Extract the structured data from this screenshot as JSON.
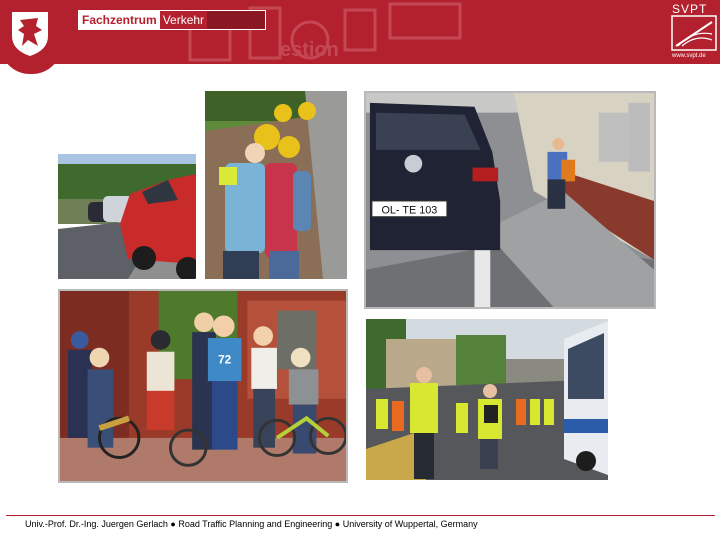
{
  "header": {
    "brand_part1": "Fachzentrum",
    "brand_part2": "Verkehr",
    "logo_title": "SVPT",
    "logo_url": "www.svpt.de",
    "background_color": "#b3202e"
  },
  "photos": [
    {
      "name": "parked-cars-street-photo"
    },
    {
      "name": "children-reading-map-photo"
    },
    {
      "name": "car-and-schoolchild-on-sidewalk-photo"
    },
    {
      "name": "children-with-bicycles-photo"
    },
    {
      "name": "group-in-safety-vests-near-bus-photo"
    }
  ],
  "plate_text": "OL- TE 103",
  "jersey_number": "72",
  "footer": {
    "text": "Univ.-Prof. Dr.-Ing. Juergen Gerlach ● Road Traffic Planning and Engineering ● University of Wuppertal, Germany"
  }
}
